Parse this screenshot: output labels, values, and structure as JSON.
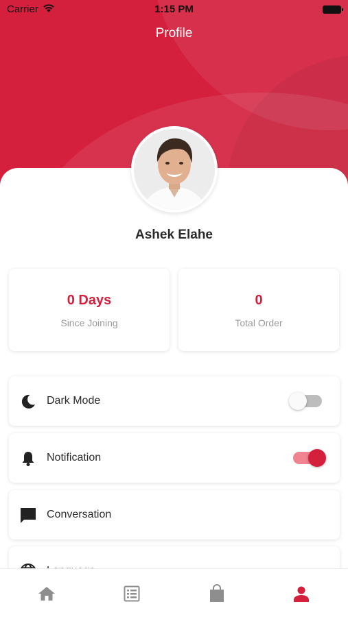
{
  "status_bar": {
    "carrier": "Carrier",
    "time": "1:15 PM"
  },
  "header": {
    "title": "Profile"
  },
  "profile": {
    "name": "Ashek Elahe"
  },
  "stats": [
    {
      "value": "0 Days",
      "label": "Since Joining"
    },
    {
      "value": "0",
      "label": "Total Order"
    }
  ],
  "menu": [
    {
      "label": "Dark Mode",
      "icon": "moon-icon",
      "toggle": false
    },
    {
      "label": "Notification",
      "icon": "bell-icon",
      "toggle": true
    },
    {
      "label": "Conversation",
      "icon": "chat-icon"
    },
    {
      "label": "Language",
      "icon": "globe-icon"
    }
  ],
  "tab_bar": {
    "items": [
      {
        "icon": "home-icon",
        "active": false
      },
      {
        "icon": "list-icon",
        "active": false
      },
      {
        "icon": "bag-icon",
        "active": false
      },
      {
        "icon": "person-icon",
        "active": true
      }
    ]
  },
  "colors": {
    "primary": "#d41f3d",
    "inactive_icon": "#8e8e8e",
    "toggle_track_on": "#f0838f"
  }
}
